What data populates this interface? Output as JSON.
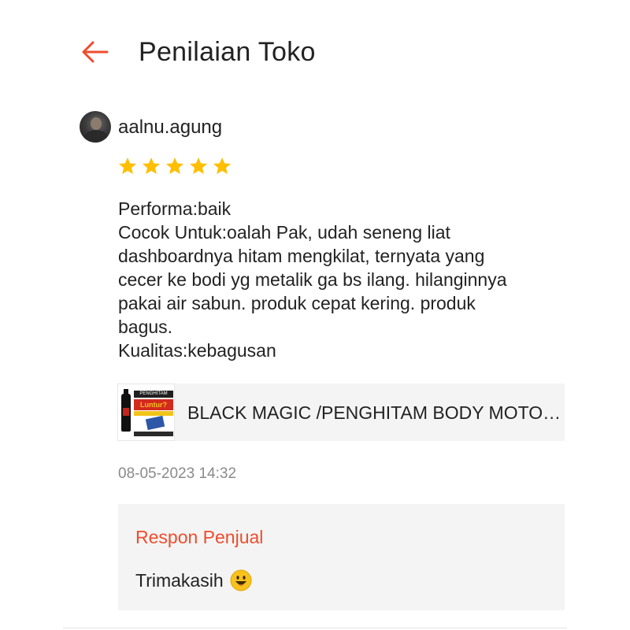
{
  "header": {
    "title": "Penilaian Toko",
    "back_icon": "back-arrow-icon",
    "accent_color": "#ee4d2d"
  },
  "review": {
    "username": "aalnu.agung",
    "rating": 5,
    "rating_max": 5,
    "star_color": "#ffbf00",
    "lines": [
      "Performa:baik",
      "Cocok Untuk:oalah Pak, udah seneng liat",
      "dashboardnya hitam mengkilat, ternyata yang",
      "cecer ke bodi yg metalik ga bs ilang. hilanginnya",
      "pakai air sabun. produk cepat kering. produk",
      "bagus.",
      "Kualitas:kebagusan"
    ],
    "product": {
      "name": "BLACK MAGIC /PENGHITAM BODY MOTOR PENGHITAM BODY MOTOR",
      "thumb_label_1": "PENGHITAM",
      "thumb_label_2": "Luntur?"
    },
    "timestamp": "08-05-2023 14:32",
    "seller_response": {
      "title": "Respon Penjual",
      "message": "Trimakasih",
      "emoji": "smiling-face-emoji"
    }
  }
}
